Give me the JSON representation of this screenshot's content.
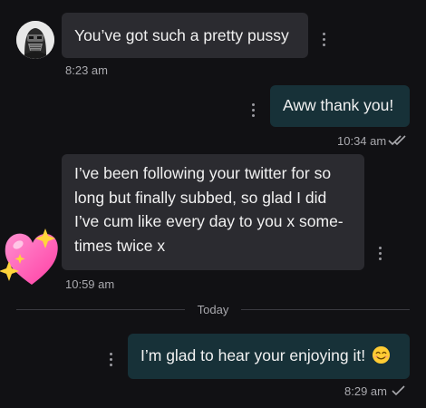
{
  "messages": [
    {
      "id": "m1",
      "direction": "incoming",
      "text": "You’ve got such a pretty pussy",
      "time": "8:23 am"
    },
    {
      "id": "m2",
      "direction": "outgoing",
      "text": "Aww thank you!",
      "time": "10:34 am",
      "status": "read"
    },
    {
      "id": "m3",
      "direction": "incoming",
      "lines": [
        "I’ve been following your twitter for so",
        "long but finally subbed, so glad I did",
        "I’ve cum like every day to you x some-",
        "times twice x"
      ],
      "time": "10:59 am"
    },
    {
      "id": "m4",
      "direction": "outgoing",
      "text": "I’m glad to hear your enjoying it!",
      "emoji": "smiling-face-emoji",
      "time": "8:29 am",
      "status": "sent"
    }
  ],
  "divider": {
    "label": "Today"
  },
  "icons": {
    "menu": "more-vertical-icon",
    "read_receipt": "double-check-icon",
    "sent_receipt": "check-icon",
    "reaction": "sparkling-heart-emoji"
  },
  "colors": {
    "background": "#111114",
    "incoming_bubble": "#2b2b30",
    "outgoing_bubble": "#173138",
    "meta_text": "#a9a9ae",
    "heart_pink": "#ff5fb4",
    "sparkle_yellow": "#ffd43b"
  }
}
